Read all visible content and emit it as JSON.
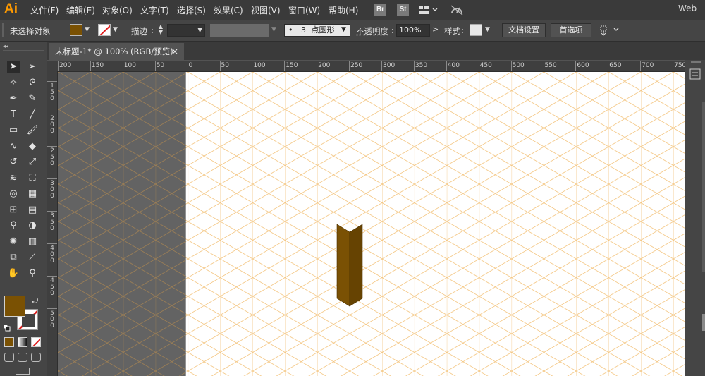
{
  "app": {
    "logo": "Ai",
    "workspace": "Web"
  },
  "menu": [
    "文件(F)",
    "编辑(E)",
    "对象(O)",
    "文字(T)",
    "选择(S)",
    "效果(C)",
    "视图(V)",
    "窗口(W)",
    "帮助(H)"
  ],
  "bridge_buttons": {
    "br": "Br",
    "st": "St"
  },
  "control_bar": {
    "selection_status": "未选择对象",
    "stroke_label": "描边",
    "brush": {
      "dot": "•",
      "size": "3",
      "shape": "点圆形"
    },
    "opacity_label": "不透明度",
    "opacity_value": "100%",
    "style_label": "样式",
    "doc_setup_button": "文档设置",
    "prefs_button": "首选项"
  },
  "document_tab": {
    "title": "未标题-1* @ 100% (RGB/预览)",
    "close": "×"
  },
  "ruler": {
    "h_ticks": [
      "200",
      "150",
      "100",
      "50",
      "0",
      "50",
      "100",
      "150",
      "200",
      "250",
      "300",
      "350",
      "400",
      "450",
      "500",
      "550",
      "600",
      "650",
      "700",
      "750"
    ],
    "v_ticks": [
      "150",
      "200",
      "250",
      "300",
      "350",
      "400",
      "450",
      "500"
    ]
  },
  "colors": {
    "fill": "#7a5103",
    "shape_light": "#7a5104",
    "shape_dark": "#664302",
    "grid": "#f4c784",
    "grid_dark": "#b08850",
    "ui_bg": "#535353",
    "panel_bg": "#454545"
  },
  "tools": [
    [
      "selection-tool",
      "direct-selection-tool"
    ],
    [
      "magic-wand-tool",
      "lasso-tool"
    ],
    [
      "pen-tool",
      "curvature-tool"
    ],
    [
      "type-tool",
      "line-tool"
    ],
    [
      "rectangle-tool",
      "paintbrush-tool"
    ],
    [
      "shaper-tool",
      "eraser-tool"
    ],
    [
      "rotate-tool",
      "scale-tool"
    ],
    [
      "warp-tool",
      "free-transform-tool"
    ],
    [
      "shape-builder-tool",
      "perspective-grid-tool"
    ],
    [
      "mesh-tool",
      "gradient-tool"
    ],
    [
      "eyedropper-tool",
      "blend-tool"
    ],
    [
      "symbol-sprayer-tool",
      "column-graph-tool"
    ],
    [
      "artboard-tool",
      "slice-tool"
    ],
    [
      "hand-tool",
      "zoom-tool"
    ]
  ]
}
